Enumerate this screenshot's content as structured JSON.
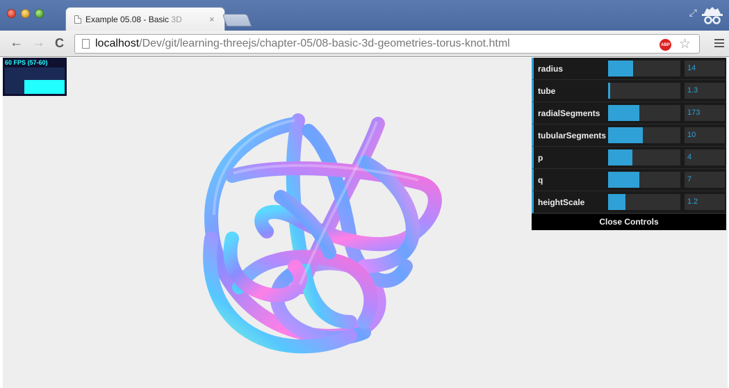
{
  "window": {
    "tab_title": "Example 05.08 - Basic ",
    "tab_title_fade": "3D",
    "tab_close": "×"
  },
  "toolbar": {
    "back": "←",
    "forward": "→",
    "reload": "C",
    "url_host": "localhost",
    "url_path": "/Dev/git/learning-threejs/chapter-05/08-basic-3d-geometries-torus-knot.html",
    "abp_label": "ABP",
    "star": "☆"
  },
  "stats": {
    "fps_text": "60 FPS (57-60)",
    "fps_fill_fraction": 0.67
  },
  "controls": {
    "rows": [
      {
        "label": "radius",
        "value": "14",
        "fill": 0.35
      },
      {
        "label": "tube",
        "value": "1.3",
        "fill": 0.03
      },
      {
        "label": "radialSegments",
        "value": "173",
        "fill": 0.43
      },
      {
        "label": "tubularSegments",
        "value": "10",
        "fill": 0.48
      },
      {
        "label": "p",
        "value": "4",
        "fill": 0.34
      },
      {
        "label": "q",
        "value": "7",
        "fill": 0.43
      },
      {
        "label": "heightScale",
        "value": "1.2",
        "fill": 0.24
      }
    ],
    "close_label": "Close Controls",
    "accent_color": "#2fa1d6"
  },
  "scene": {
    "background": "#eeeeee",
    "object": "torus-knot",
    "material": "normal-material"
  }
}
